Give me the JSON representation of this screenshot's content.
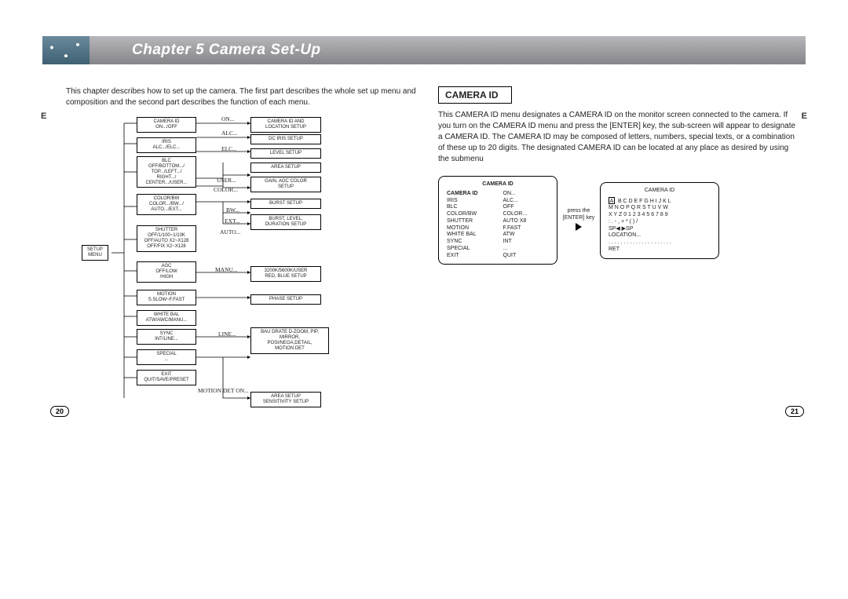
{
  "chapter_title": "Chapter 5    Camera Set-Up",
  "intro_text": "This chapter describes how to set up the camera. The first part describes the whole set up menu and composition and the second part describes the function of each menu.",
  "side_letter": "E",
  "page_num_left": "20",
  "page_num_right": "21",
  "diagram": {
    "root": "SETUP\nMENU",
    "col2": [
      "CAMERA ID\nON.../OFF",
      "IRIS\nALC.../ELC...",
      "BLC\nOFF/BOTTOM.../\nTOP.../LEFT.../\nRIGHT.../\nCENTER.../USER...",
      "COLOR/BW\nCOLOR.../BW.../\nAUTO.../EXT...",
      "SHUTTER\nOFF/1/100~1/10K\nOFF/AUTO X2~X128\nOFF/FIX X2~X128",
      "AGC\nOFF/LOW\n/HIGH",
      "MOTION\nS.SLOW~F.FAST",
      "WHITE BAL\nATW/AWC/MANU...",
      "SYNC\nINT/LINE...",
      "SPECIAL\n...",
      "EXIT\nQUIT/SAVE/PRESET"
    ],
    "labels": [
      "ON...",
      "ALC...",
      "ELC...",
      "USER...",
      "COLOR...",
      "BW...",
      "EXT...",
      "AUTO...",
      "MANU...",
      "LINE...",
      "MOTION DET ON..."
    ],
    "col3": [
      "CAMERA ID AND\nLOCATION SETUP",
      "DC IRIS SETUP",
      "LEVEL SETUP",
      "AREA SETUP",
      "GAIN, AGC COLOR\nSETUP",
      "BURST SETUP",
      "BURST, LEVEL,\nDURATION SETUP",
      "3200K/5600K/USER\nRED, BLUE SETUP",
      "PHASE SETUP",
      "BAU DRATE D-ZOOM, PIP,\nMIRROR,\nPOSI/NEGA,DETAIL,\nMOTION DET",
      "AREA SETUP\nSENSITIVITY SETUP"
    ]
  },
  "section_title": "CAMERA ID",
  "body_text": "This CAMERA ID menu designates a CAMERA ID on the monitor screen connected to the camera. If you turn on the CAMERA ID menu and press the [ENTER] key, the sub-screen will appear to designate a CAMERA ID. The CAMERA ID may be composed of letters, numbers,  special texts, or a combination of these up to 20 digits. The designated CAMERA ID can be located at any place as desired by using the submenu",
  "screen1": {
    "title": "CAMERA ID",
    "rows": [
      [
        "CAMERA ID",
        "ON..."
      ],
      [
        "IRIS",
        "ALC..."
      ],
      [
        "BLC",
        "OFF"
      ],
      [
        "COLOR/BW",
        "COLOR..."
      ],
      [
        "SHUTTER",
        "AUTO X8"
      ],
      [
        "MOTION",
        "F.FAST"
      ],
      [
        "WHITE BAL",
        "ATW"
      ],
      [
        "SYNC",
        "INT"
      ],
      [
        "SPECIAL",
        "..."
      ],
      [
        "EXIT",
        "QUIT"
      ]
    ]
  },
  "arrow_note": "press the [ENTER] key",
  "screen2": {
    "title": "CAMERA ID",
    "selected_char": "A",
    "lines": [
      "  B  C  D  E  F  G  H  I  J  K  L",
      "M  N  O  P  Q  R  S  T  U  V  W",
      "X  Y  Z  0  1  2  3  4  5  6  7  8  9",
      ":   .   -   ,   +   *   (   )   /",
      "SP◀  ▶SP",
      "LOCATION...",
      ". . . . . . . . . . . . . . . . . . . . .",
      "RET"
    ]
  }
}
